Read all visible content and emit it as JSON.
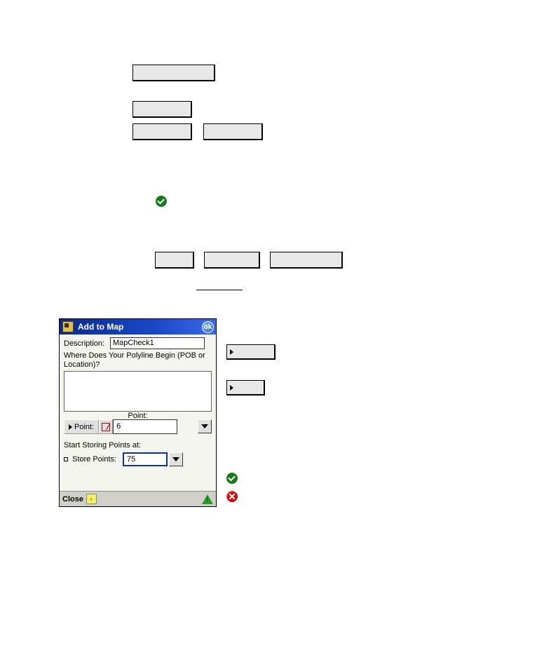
{
  "dialog": {
    "title": "Add to Map",
    "ok": "ok",
    "description_label": "Description:",
    "description_value": "MapCheck1",
    "prompt": "Where Does Your Polyline Begin (POB or Location)?",
    "point_label": "Point:",
    "point_button": "Point:",
    "point_value": "6",
    "storing_section": "Start Storing Points at:",
    "store_points_label": "Store Points:",
    "store_points_value": "75",
    "close": "Close"
  }
}
